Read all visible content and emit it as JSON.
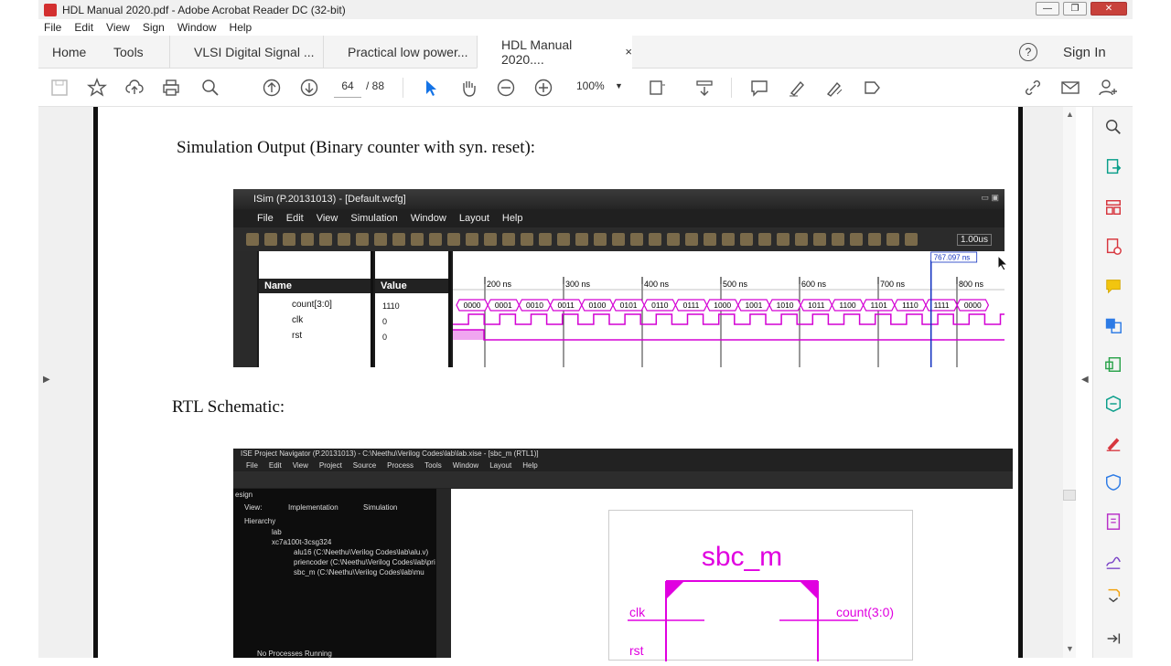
{
  "window": {
    "title": "HDL Manual 2020.pdf - Adobe Acrobat Reader DC (32-bit)",
    "controls": [
      "—",
      "❐",
      "✕"
    ]
  },
  "menu": [
    "File",
    "Edit",
    "View",
    "Sign",
    "Window",
    "Help"
  ],
  "tabs": {
    "home": "Home",
    "tools": "Tools",
    "docs": [
      "VLSI Digital Signal ...",
      "Practical low power...",
      "HDL Manual 2020...."
    ],
    "close": "×"
  },
  "header_right": {
    "help": "?",
    "sign_in": "Sign In"
  },
  "toolbar": {
    "page_current": "64",
    "page_total": "/ 88",
    "zoom": "100%"
  },
  "document": {
    "heading_sim": "Simulation Output (Binary counter with syn. reset):",
    "heading_rtl": "RTL Schematic:"
  },
  "isim": {
    "title": "ISim (P.20131013) - [Default.wcfg]",
    "menu": [
      "File",
      "Edit",
      "View",
      "Simulation",
      "Window",
      "Layout",
      "Help"
    ],
    "speed": "1.00us",
    "col_name": "Name",
    "col_value": "Value",
    "signals": [
      {
        "name": "count[3:0]",
        "value": "1110"
      },
      {
        "name": "clk",
        "value": "0"
      },
      {
        "name": "rst",
        "value": "0"
      }
    ],
    "cursor_time": "767.097 ns",
    "time_ticks": [
      "200 ns",
      "300 ns",
      "400 ns",
      "500 ns",
      "600 ns",
      "700 ns",
      "800 ns"
    ],
    "count_values": [
      "0000",
      "0001",
      "0010",
      "0011",
      "0100",
      "0101",
      "0110",
      "0111",
      "1000",
      "1001",
      "1010",
      "1011",
      "1100",
      "1101",
      "1110",
      "1111",
      "0000"
    ],
    "wave_color": "#d400d4"
  },
  "rtl": {
    "title": "ISE Project Navigator (P.20131013) - C:\\Neethu\\Verilog Codes\\lab\\lab.xise - [sbc_m (RTL1)]",
    "menu": [
      "File",
      "Edit",
      "View",
      "Project",
      "Source",
      "Process",
      "Tools",
      "Window",
      "Layout",
      "Help"
    ],
    "panel_title": "esign",
    "view_label": "View:",
    "view_impl": "Implementation",
    "view_sim": "Simulation",
    "hierarchy": "Hierarchy",
    "tree": [
      "lab",
      "xc7a100t-3csg324",
      "alu16 (C:\\Neethu\\Verilog Codes\\lab\\alu.v)",
      "priencoder (C:\\Neethu\\Verilog Codes\\lab\\pri",
      "sbc_m (C:\\Neethu\\Verilog Codes\\lab\\mu"
    ],
    "process": "No Processes Running",
    "module_name": "sbc_m",
    "port_clk": "clk",
    "port_rst": "rst",
    "port_count": "count(3:0)"
  },
  "colors": {
    "accent": "#1473e6",
    "wave": "#d400d4",
    "ise_bg": "#1a1a1a"
  }
}
